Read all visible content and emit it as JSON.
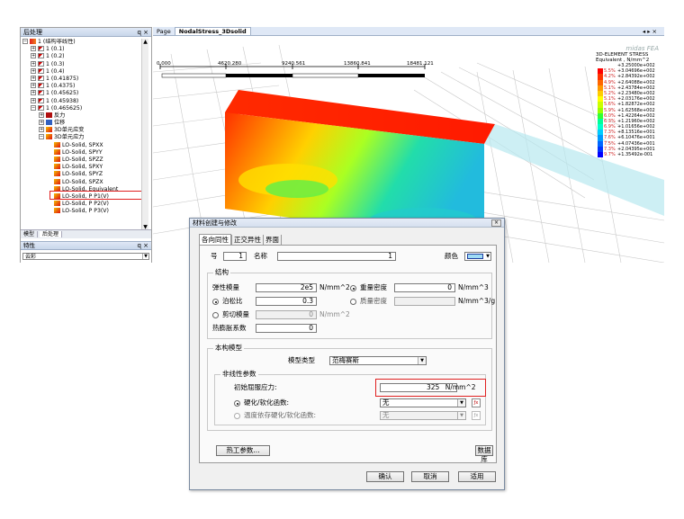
{
  "left_panel": {
    "title": "后处理",
    "controls": "ɋ ×",
    "tree": [
      {
        "label": "1 (结构非线性)",
        "indent": 0,
        "exp": "−",
        "icon": "ic-red"
      },
      {
        "label": "1 (0.1)",
        "indent": 1,
        "exp": "+",
        "icon": "ic-lc"
      },
      {
        "label": "1 (0.2)",
        "indent": 1,
        "exp": "+",
        "icon": "ic-lc"
      },
      {
        "label": "1 (0.3)",
        "indent": 1,
        "exp": "+",
        "icon": "ic-lc"
      },
      {
        "label": "1 (0.4)",
        "indent": 1,
        "exp": "+",
        "icon": "ic-lc"
      },
      {
        "label": "1 (0.41875)",
        "indent": 1,
        "exp": "+",
        "icon": "ic-lc"
      },
      {
        "label": "1 (0.4375)",
        "indent": 1,
        "exp": "+",
        "icon": "ic-lc"
      },
      {
        "label": "1 (0.45625)",
        "indent": 1,
        "exp": "+",
        "icon": "ic-lc"
      },
      {
        "label": "1 (0.45938)",
        "indent": 1,
        "exp": "+",
        "icon": "ic-lc"
      },
      {
        "label": "1 (0.465625)",
        "indent": 1,
        "exp": "−",
        "icon": "ic-lc"
      },
      {
        "label": "反力",
        "indent": 2,
        "exp": "+",
        "icon": "ic-force"
      },
      {
        "label": "位移",
        "indent": 2,
        "exp": "+",
        "icon": "ic-disp"
      },
      {
        "label": "3D单元应变",
        "indent": 2,
        "exp": "+",
        "icon": "ic-solid"
      },
      {
        "label": "3D单元应力",
        "indent": 2,
        "exp": "−",
        "icon": "ic-solid"
      },
      {
        "label": "LO-Solid, SPXX",
        "indent": 3,
        "exp": "",
        "icon": "ic-solid"
      },
      {
        "label": "LO-Solid, SPYY",
        "indent": 3,
        "exp": "",
        "icon": "ic-solid"
      },
      {
        "label": "LO-Solid, SPZZ",
        "indent": 3,
        "exp": "",
        "icon": "ic-solid"
      },
      {
        "label": "LO-Solid, SPXY",
        "indent": 3,
        "exp": "",
        "icon": "ic-solid"
      },
      {
        "label": "LO-Solid, SPYZ",
        "indent": 3,
        "exp": "",
        "icon": "ic-solid"
      },
      {
        "label": "LO-Solid, SPZX",
        "indent": 3,
        "exp": "",
        "icon": "ic-solid"
      },
      {
        "label": "LO-Solid, Equivalent",
        "indent": 3,
        "exp": "",
        "icon": "ic-solid"
      },
      {
        "label": "LO-Solid, P P1(V)",
        "indent": 3,
        "exp": "",
        "icon": "ic-solid"
      },
      {
        "label": "LO-Solid, P P2(V)",
        "indent": 3,
        "exp": "",
        "icon": "ic-solid"
      },
      {
        "label": "LO-Solid, P P3(V)",
        "indent": 3,
        "exp": "",
        "icon": "ic-solid"
      }
    ],
    "tabs": [
      "模型",
      "后处理"
    ],
    "props_title": "特性",
    "props_value": "云彩"
  },
  "view": {
    "tab_page": "Page",
    "tab_active": "NodalStress_3Dsolid",
    "controls": "◂ ▸ ×",
    "ruler": [
      "0.000",
      "4620.280",
      "9240.561",
      "13860.841",
      "18481.121"
    ],
    "legend": {
      "brand": "midas FEA",
      "title1": "3D-ELEMENT STRESS",
      "title2": "Equivalent , N/mm^2",
      "top": "+3.25000e+002",
      "rows": [
        {
          "pct": "5.5%",
          "val": "+3.04696e+002",
          "color": "#ff0000"
        },
        {
          "pct": "4.2%",
          "val": "+2.84392e+002",
          "color": "#ff3300"
        },
        {
          "pct": "4.9%",
          "val": "+2.64088e+002",
          "color": "#ff6600"
        },
        {
          "pct": "5.1%",
          "val": "+2.43784e+002",
          "color": "#ff9900"
        },
        {
          "pct": "5.2%",
          "val": "+2.23480e+002",
          "color": "#ffcc00"
        },
        {
          "pct": "5.1%",
          "val": "+2.03176e+002",
          "color": "#ffff00"
        },
        {
          "pct": "5.6%",
          "val": "+1.82872e+002",
          "color": "#ccff00"
        },
        {
          "pct": "5.9%",
          "val": "+1.62568e+002",
          "color": "#99ff00"
        },
        {
          "pct": "6.0%",
          "val": "+1.42264e+002",
          "color": "#33ff33"
        },
        {
          "pct": "6.3%",
          "val": "+1.21960e+002",
          "color": "#00ff99"
        },
        {
          "pct": "6.9%",
          "val": "+1.01656e+002",
          "color": "#00ffcc"
        },
        {
          "pct": "7.3%",
          "val": "+8.13516e+001",
          "color": "#00ccff"
        },
        {
          "pct": "7.6%",
          "val": "+6.10476e+001",
          "color": "#0099ff"
        },
        {
          "pct": "7.5%",
          "val": "+4.07436e+001",
          "color": "#0066ff"
        },
        {
          "pct": "7.3%",
          "val": "+2.04395e+001",
          "color": "#0033ff"
        },
        {
          "pct": "9.7%",
          "val": "+1.35492e-001",
          "color": "#0000ff"
        }
      ]
    }
  },
  "dialog": {
    "title": "材料创建与修改",
    "close": "×",
    "tabs": [
      "各向同性",
      "正交异性",
      "界面"
    ],
    "number_label": "号",
    "number_value": "1",
    "name_label": "名称",
    "name_value": "1",
    "color_label": "颜色",
    "structure_group": "结构",
    "elastic_label": "弹性模量",
    "elastic_value": "2e5",
    "elastic_unit": "N/mm^2",
    "weight_density_label": "重量密度",
    "weight_density_value": "0",
    "weight_density_unit": "N/mm^3",
    "poisson_label": "泊松比",
    "poisson_value": "0.3",
    "mass_density_label": "质量密度",
    "mass_density_value": "",
    "mass_density_unit": "N/mm^3/g",
    "shear_label": "剪切模量",
    "shear_value": "0",
    "shear_unit": "N/mm^2",
    "thermal_label": "热膨胀系数",
    "thermal_value": "0",
    "constitutive_group": "本构模型",
    "model_type_label": "模型类型",
    "model_type_value": "范梅赛斯",
    "nonlinear_group": "非线性参数",
    "yield_label": "初始屈服应力:",
    "yield_value": "325",
    "yield_unit": "N/mm^2",
    "hardening_label": "硬化/软化函数:",
    "hardening_value": "无",
    "temp_hardening_label": "温度依存硬化/软化函数:",
    "temp_hardening_value": "无",
    "thermal_params_button": "热工参数...",
    "library_button": "数据库",
    "ok_button": "确认",
    "cancel_button": "取消",
    "apply_button": "适用"
  },
  "colors": {
    "highlight": "#e02020",
    "color_swatch": "#9fdcf5"
  }
}
